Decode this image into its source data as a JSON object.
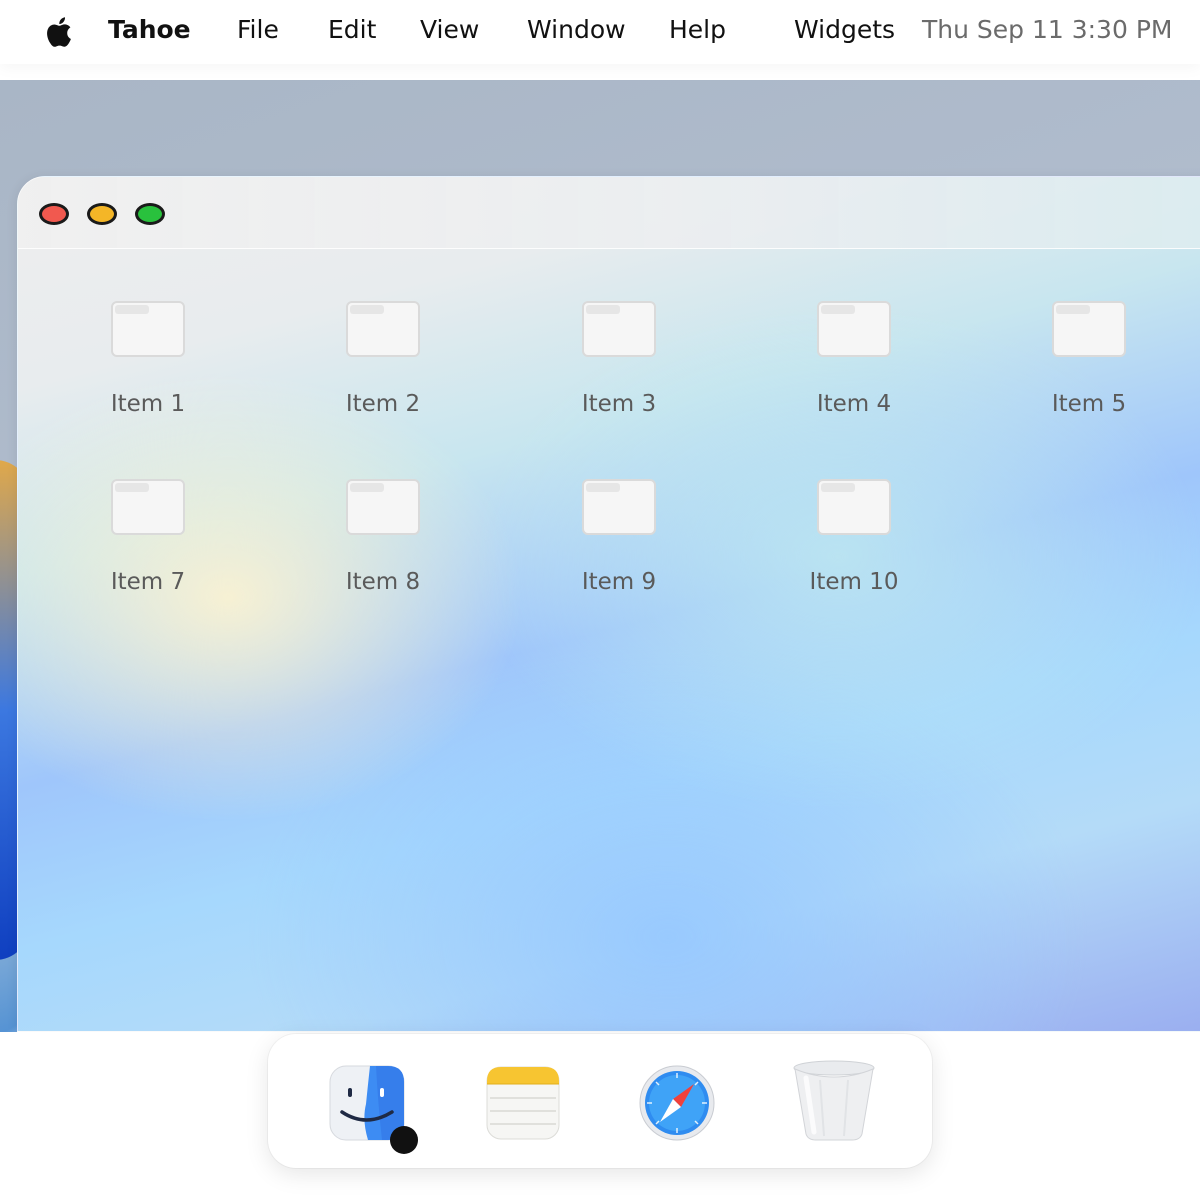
{
  "menubar": {
    "app_name": "Tahoe",
    "menus": [
      "File",
      "Edit",
      "View",
      "Window",
      "Help"
    ],
    "widgets": "Widgets",
    "clock": "Thu Sep 11 3:30 PM"
  },
  "window": {
    "items": [
      {
        "label": "Item 1"
      },
      {
        "label": "Item 2"
      },
      {
        "label": "Item 3"
      },
      {
        "label": "Item 4"
      },
      {
        "label": "Item 5"
      },
      {
        "label": "Item 7"
      },
      {
        "label": "Item 8"
      },
      {
        "label": "Item 9"
      },
      {
        "label": "Item 10"
      }
    ]
  },
  "dock": {
    "apps": [
      {
        "icon": "finder-icon",
        "running": true
      },
      {
        "icon": "notes-icon",
        "running": false
      },
      {
        "icon": "safari-icon",
        "running": false
      },
      {
        "icon": "trash-icon",
        "running": false
      }
    ]
  },
  "colors": {
    "close": "#f1594f",
    "minimize": "#f4b627",
    "zoom": "#29c13d"
  }
}
